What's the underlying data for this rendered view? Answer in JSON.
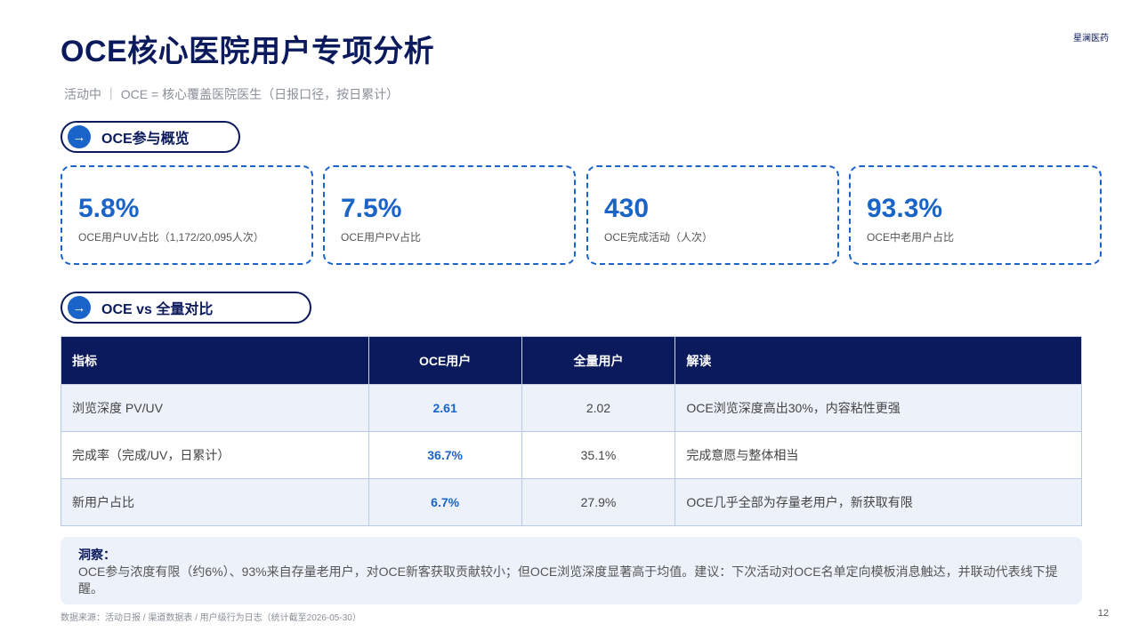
{
  "header": {
    "title": "OCE核心医院用户专项分析",
    "brand": "星澜医药",
    "subtitle": "活动中 ｜ OCE = 核心覆盖医院医生（日报口径，按日累计）"
  },
  "section1": {
    "arrow": "→",
    "label": "OCE参与概览"
  },
  "kpis": [
    {
      "value": "5.8%",
      "desc": "OCE用户UV占比（1,172/20,095人次）"
    },
    {
      "value": "7.5%",
      "desc": "OCE用户PV占比"
    },
    {
      "value": "430",
      "desc": "OCE完成活动（人次）"
    },
    {
      "value": "93.3%",
      "desc": "OCE中老用户占比"
    }
  ],
  "section2": {
    "arrow": "→",
    "label": "OCE vs 全量对比"
  },
  "table": {
    "headers": [
      "指标",
      "OCE用户",
      "全量用户",
      "解读"
    ],
    "rows": [
      [
        "浏览深度 PV/UV",
        "2.61",
        "2.02",
        "OCE浏览深度高出30%，内容粘性更强"
      ],
      [
        "完成率（完成/UV，日累计）",
        "36.7%",
        "35.1%",
        "完成意愿与整体相当"
      ],
      [
        "新用户占比",
        "6.7%",
        "27.9%",
        "OCE几乎全部为存量老用户，新获取有限"
      ]
    ]
  },
  "insight": {
    "title": "洞察：",
    "text": "OCE参与浓度有限（约6%）、93%来自存量老用户，对OCE新客获取贡献较小；但OCE浏览深度显著高于均值。建议：下次活动对OCE名单定向模板消息触达，并联动代表线下提醒。"
  },
  "footer": {
    "source": "数据来源：活动日报 / 渠道数据表 / 用户级行为日志（统计截至2026-05-30）",
    "page": "12"
  },
  "colors": {
    "navy": "#0b1a5c",
    "accent": "#1a63c8",
    "light": "#edf2fa"
  }
}
